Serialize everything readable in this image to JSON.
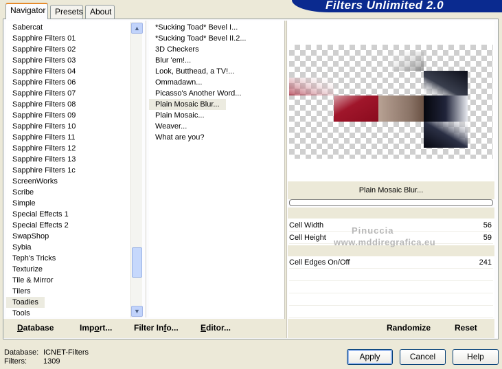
{
  "tabs": [
    "Navigator",
    "Presets",
    "About"
  ],
  "banner": "Filters Unlimited 2.0",
  "categories": [
    "Sabercat",
    "Sapphire Filters 01",
    "Sapphire Filters 02",
    "Sapphire Filters 03",
    "Sapphire Filters 04",
    "Sapphire Filters 06",
    "Sapphire Filters 07",
    "Sapphire Filters 08",
    "Sapphire Filters 09",
    "Sapphire Filters 10",
    "Sapphire Filters 11",
    "Sapphire Filters 12",
    "Sapphire Filters 13",
    "Sapphire Filters 1c",
    "ScreenWorks",
    "Scribe",
    "Simple",
    "Special Effects 1",
    "Special Effects 2",
    "SwapShop",
    "Sybia",
    "Teph's Tricks",
    "Texturize",
    "Tile & Mirror",
    "Tilers",
    "Toadies",
    "Tools"
  ],
  "selected_category": "Toadies",
  "filters": [
    "*Sucking Toad*  Bevel I...",
    "*Sucking Toad*  Bevel II.2...",
    "3D Checkers",
    "Blur 'em!...",
    "Look, Butthead, a TV!...",
    "Ommadawn...",
    "Picasso's Another Word...",
    "Plain Mosaic Blur...",
    "Plain Mosaic...",
    "Weaver...",
    "What are you?"
  ],
  "selected_filter": "Plain Mosaic Blur...",
  "filter_name": "Plain Mosaic Blur...",
  "params": [
    {
      "label": "Cell Width",
      "value": "56"
    },
    {
      "label": "Cell Height",
      "value": "59"
    },
    {
      "label": "Cell Edges On/Off",
      "value": "241"
    }
  ],
  "bottom_buttons": {
    "database": "Database",
    "import": "Import...",
    "filter_info": "Filter Info...",
    "editor": "Editor...",
    "randomize": "Randomize",
    "reset": "Reset"
  },
  "status": {
    "database_label": "Database:",
    "database_value": "ICNET-Filters",
    "filters_label": "Filters:",
    "filters_value": "1309"
  },
  "dialog_buttons": {
    "apply": "Apply",
    "cancel": "Cancel",
    "help": "Help"
  },
  "watermark": {
    "line1": "Pinuccia",
    "line2": "www.mddiregrafica.eu"
  },
  "icons": {
    "scroll_up": "chevron-up-icon",
    "scroll_down": "chevron-down-icon"
  }
}
